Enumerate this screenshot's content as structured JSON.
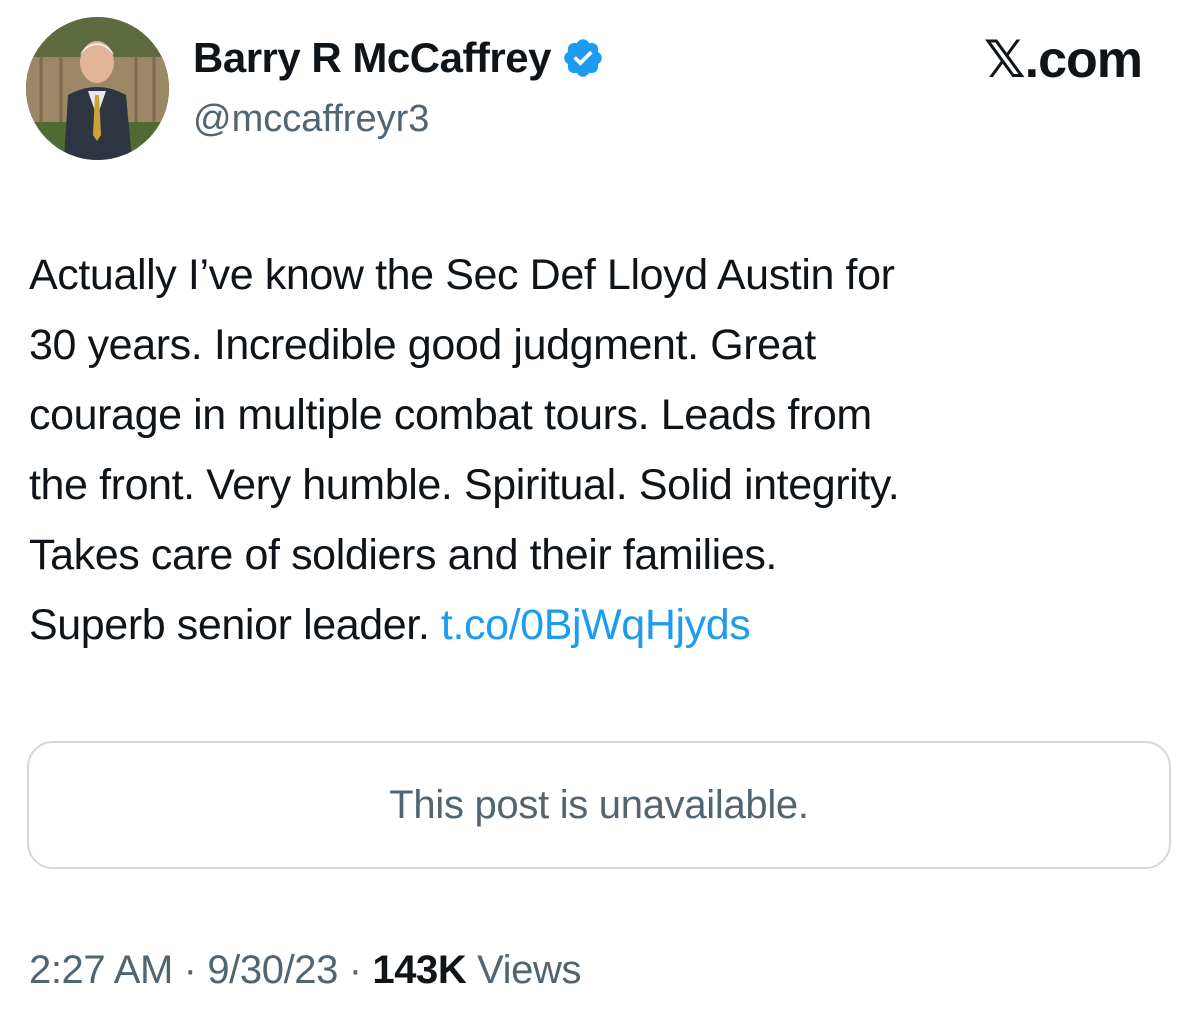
{
  "author": {
    "display_name": "Barry R McCaffrey",
    "handle": "@mccaffreyr3",
    "verified_icon": "verified-badge-icon",
    "verified_color": "#1d9bf0"
  },
  "watermark": "𝕏.com",
  "tweet": {
    "lines": [
      "Actually I’ve know the Sec Def Lloyd Austin for",
      "30 years. Incredible good judgment. Great",
      "courage in multiple combat tours. Leads from",
      "the front. Very humble. Spiritual. Solid integrity.",
      "Takes care of soldiers and their families."
    ],
    "last_line_text": "Superb senior leader. ",
    "link": "t.co/0BjWqHjyds",
    "link_color": "#1d9bf0"
  },
  "quote_card": {
    "text": "This post is unavailable."
  },
  "meta": {
    "time": "2:27 AM",
    "separator": " · ",
    "date": "9/30/23",
    "views_count": "143K",
    "views_label": " Views"
  }
}
